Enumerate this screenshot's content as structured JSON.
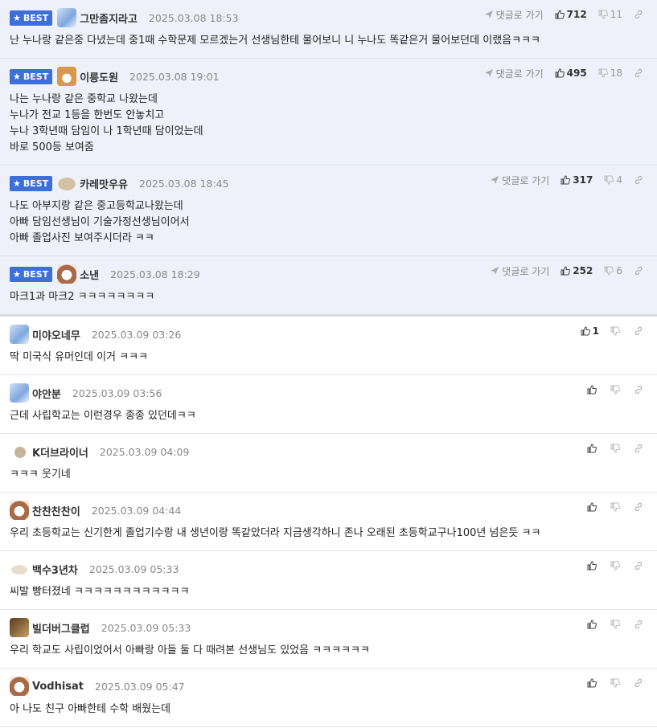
{
  "labels": {
    "best": "BEST",
    "reply": "댓글로 가기"
  },
  "comments": [
    {
      "best": true,
      "avatar": "blue",
      "nick": "그만좀지라고",
      "date": "2025.03.08 18:53",
      "likes": "712",
      "dislikes": "11",
      "lines": [
        "난 누나랑 같은중 다녔는데 중1때 수학문제 모르겠는거 선생님한테 물어보니 니 누나도 똑같은거 물어보던데 이랬음ㅋㅋㅋ"
      ]
    },
    {
      "best": true,
      "avatar": "dog",
      "nick": "이릉도원",
      "date": "2025.03.08 19:01",
      "likes": "495",
      "dislikes": "18",
      "lines": [
        "나는 누나랑 같은 중학교 나왔는데",
        "누나가 전교 1등을 한번도 안놓치고",
        "누나 3학년때 담임이 나 1학년때 담이었는데",
        "바로 500등 보여줌"
      ]
    },
    {
      "best": true,
      "avatar": "potato",
      "nick": "카레맛우유",
      "date": "2025.03.08 18:45",
      "likes": "317",
      "dislikes": "4",
      "lines": [
        "나도 아부지랑 같은 중고등학교나왔는데",
        "아빠 담임선생님이 기술가정선생님이어서",
        "아빠 졸업사진 보여주시더라 ㅋㅋ"
      ]
    },
    {
      "best": true,
      "avatar": "bear",
      "nick": "소낸",
      "date": "2025.03.08 18:29",
      "likes": "252",
      "dislikes": "6",
      "lines": [
        "마크1과 마크2 ㅋㅋㅋㅋㅋㅋㅋㅋ"
      ]
    },
    {
      "best": false,
      "avatar": "blue",
      "nick": "미야오네무",
      "date": "2025.03.09 03:26",
      "likes": "1",
      "dislikes": "",
      "lines": [
        "딱 미국식 유머인데 이거 ㅋㅋㅋ"
      ]
    },
    {
      "best": false,
      "avatar": "blue",
      "nick": "야안분",
      "date": "2025.03.09 03:56",
      "likes": "",
      "dislikes": "",
      "lines": [
        "근데 사립학교는 이런경우 종종 있던데ㅋㅋ"
      ]
    },
    {
      "best": false,
      "avatar": "dot",
      "nick": "K더브라이너",
      "date": "2025.03.09 04:09",
      "likes": "",
      "dislikes": "",
      "lines": [
        "ㅋㅋㅋ 웃기네"
      ]
    },
    {
      "best": false,
      "avatar": "bear",
      "nick": "찬찬찬찬이",
      "date": "2025.03.09 04:44",
      "likes": "",
      "dislikes": "",
      "lines": [
        "우리 초등학교는 신기한게 졸업기수랑 내 생년이랑 똑같았더라 지금생각하니 존나 오래된 초등학교구나100년 넘은듯 ㅋㅋ"
      ]
    },
    {
      "best": false,
      "avatar": "pup",
      "nick": "백수3년차",
      "date": "2025.03.09 05:33",
      "likes": "",
      "dislikes": "",
      "lines": [
        "씨발 빵터졌네 ㅋㅋㅋㅋㅋㅋㅋㅋㅋㅋㅋㅋ"
      ]
    },
    {
      "best": false,
      "avatar": "bug",
      "nick": "빌더버그클럽",
      "date": "2025.03.09 05:33",
      "likes": "",
      "dislikes": "",
      "lines": [
        "우리 학교도 사립이었어서 아빠랑 아들 둘 다 때려본 선생님도 있었음 ㅋㅋㅋㅋㅋㅋ"
      ]
    },
    {
      "best": false,
      "avatar": "bear",
      "nick": "Vodhisat",
      "date": "2025.03.09 05:47",
      "likes": "",
      "dislikes": "",
      "lines": [
        "아 나도 친구 아빠한테 수학 배웠는데"
      ]
    }
  ]
}
